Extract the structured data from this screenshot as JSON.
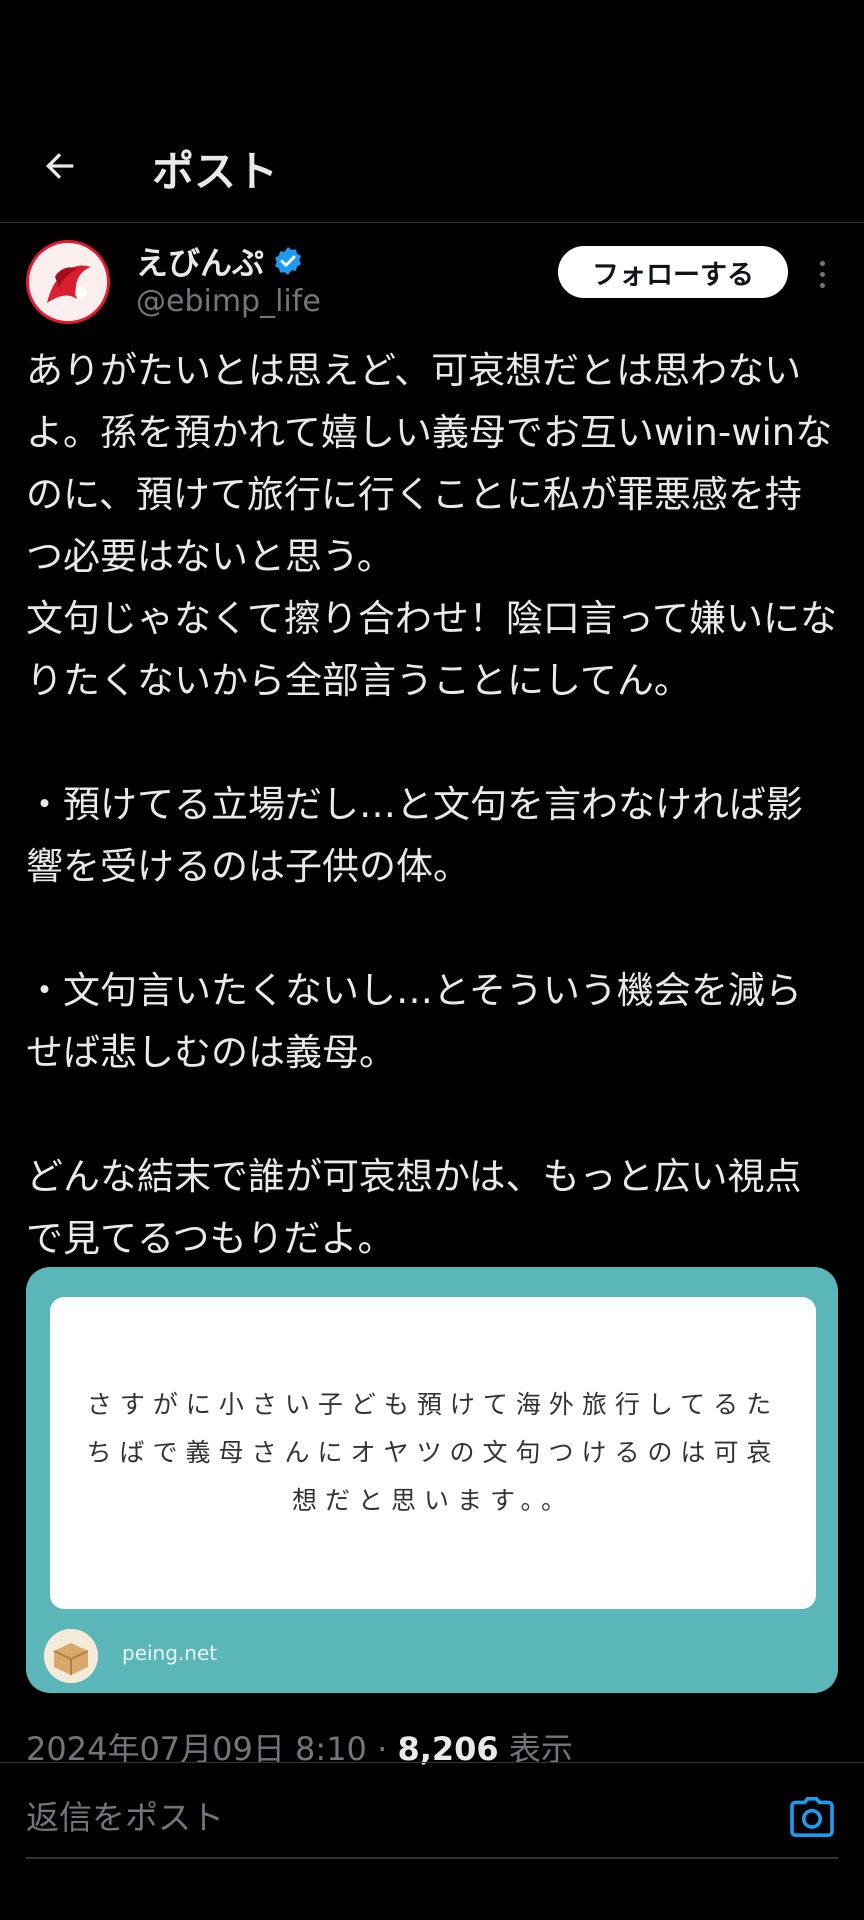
{
  "header": {
    "title": "ポスト",
    "back_icon": "arrow-left-icon"
  },
  "post": {
    "author": {
      "name": "えびんぷ",
      "handle": "@ebimp_life",
      "verified": true,
      "badge_color": "#1d9bf0"
    },
    "follow_label": "フォローする",
    "text": "ありがたいとは思えど、可哀想だとは思わないよ。孫を預かれて嬉しい義母でお互いwin-winなのに、預けて旅行に行くことに私が罪悪感を持つ必要はないと思う。\n文句じゃなくて擦り合わせ！陰口言って嫌いになりたくないから全部言うことにしてん。\n\n・預けてる立場だし…と文句を言わなければ影響を受けるのは子供の体。\n\n・文句言いたくないし…とそういう機会を減らせば悲しむのは義母。\n\nどんな結末で誰が可哀想かは、もっと広い視点で見てるつもりだよ。",
    "card": {
      "question": "さすがに小さい子ども預けて海外旅行してるたちばで義母さんにオヤツの文句つけるのは可哀想だと思います。。",
      "source": "peing.net",
      "bg_color": "#5ab6b8"
    },
    "timestamp": "2024年07月09日 8:10",
    "separator": "·",
    "views_count": "8,206",
    "views_label": "表示"
  },
  "reply": {
    "placeholder": "返信をポスト",
    "camera_icon": "camera-icon"
  }
}
